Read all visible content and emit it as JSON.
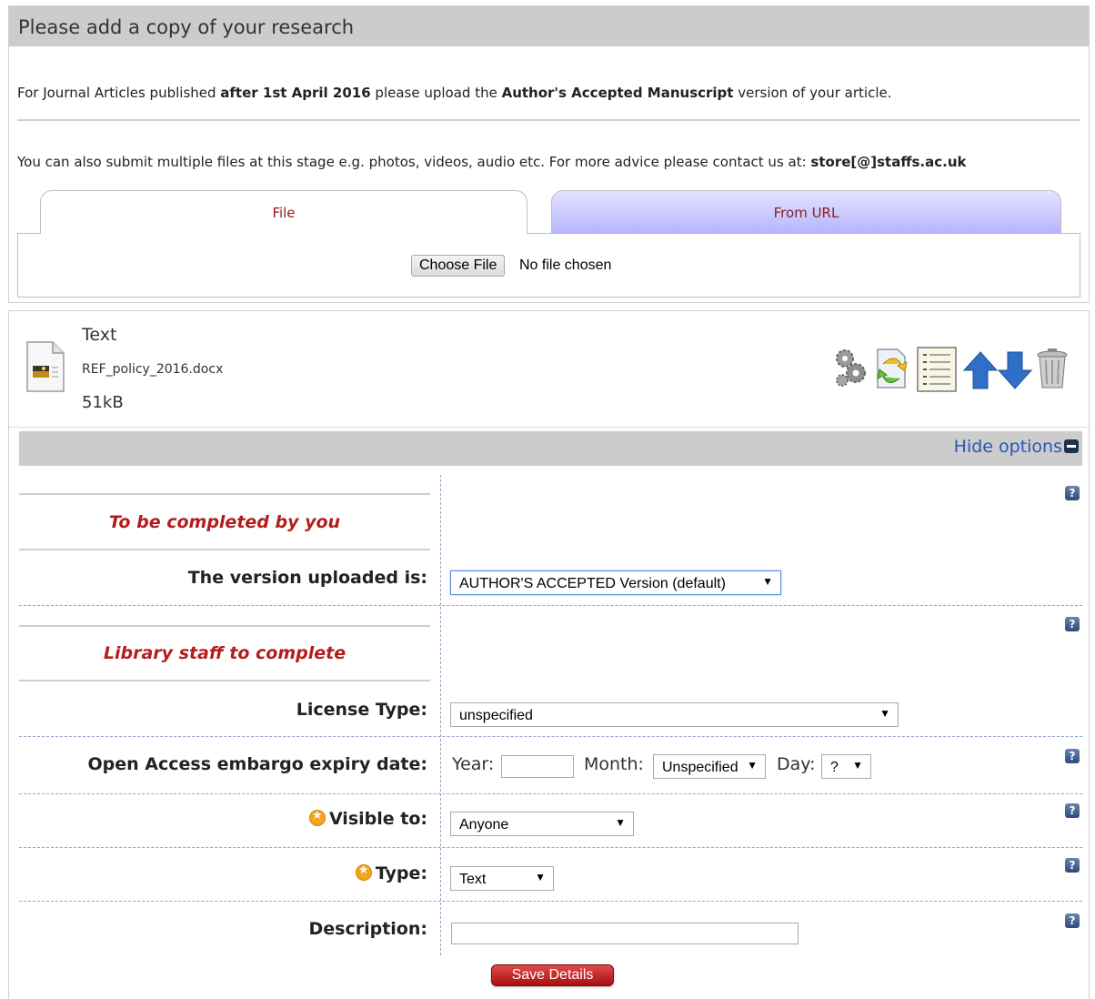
{
  "panel": {
    "heading": "Please add a copy of your research",
    "intro1": {
      "pre": "For Journal Articles published ",
      "bold1": "after 1st April 2016",
      "mid": " please upload the ",
      "bold2": "Author's Accepted Manuscript",
      "post": " version of your article."
    },
    "intro2": {
      "pre": "You can also submit multiple files at this stage e.g. photos, videos, audio etc. For more advice please contact us at: ",
      "bold": "store[@]staffs.ac.uk"
    },
    "tabs": [
      {
        "label": "File",
        "active": true
      },
      {
        "label": "From URL",
        "active": false
      }
    ],
    "choose_file": "Choose File",
    "no_file": "No file chosen"
  },
  "file": {
    "type": "Text",
    "name": "REF_policy_2016.docx",
    "size": "51kB",
    "icons": [
      "gears-icon",
      "convert-icon",
      "document-list-icon",
      "arrow-up-icon",
      "arrow-down-icon",
      "trash-icon"
    ]
  },
  "options": {
    "hide_label": "Hide options",
    "section1": "To be completed by you",
    "section2": "Library staff to complete",
    "version_label": "The version uploaded is:",
    "version_value": "AUTHOR'S ACCEPTED Version (default)",
    "license_label": "License Type:",
    "license_value": "unspecified",
    "embargo_label": "Open Access embargo expiry date:",
    "year_label": "Year:",
    "year_value": "",
    "month_label": "Month:",
    "month_value": "Unspecified",
    "day_label": "Day:",
    "day_value": "?",
    "visible_label": "Visible to:",
    "visible_value": "Anyone",
    "type_label": "Type:",
    "type_value": "Text",
    "description_label": "Description:",
    "description_value": "",
    "help": "?",
    "save": "Save Details"
  },
  "colors": {
    "accent_red": "#b31d1d",
    "link_blue": "#2a56b8",
    "header_gray": "#cccccc",
    "tab_inactive": "#c9c6ff"
  }
}
